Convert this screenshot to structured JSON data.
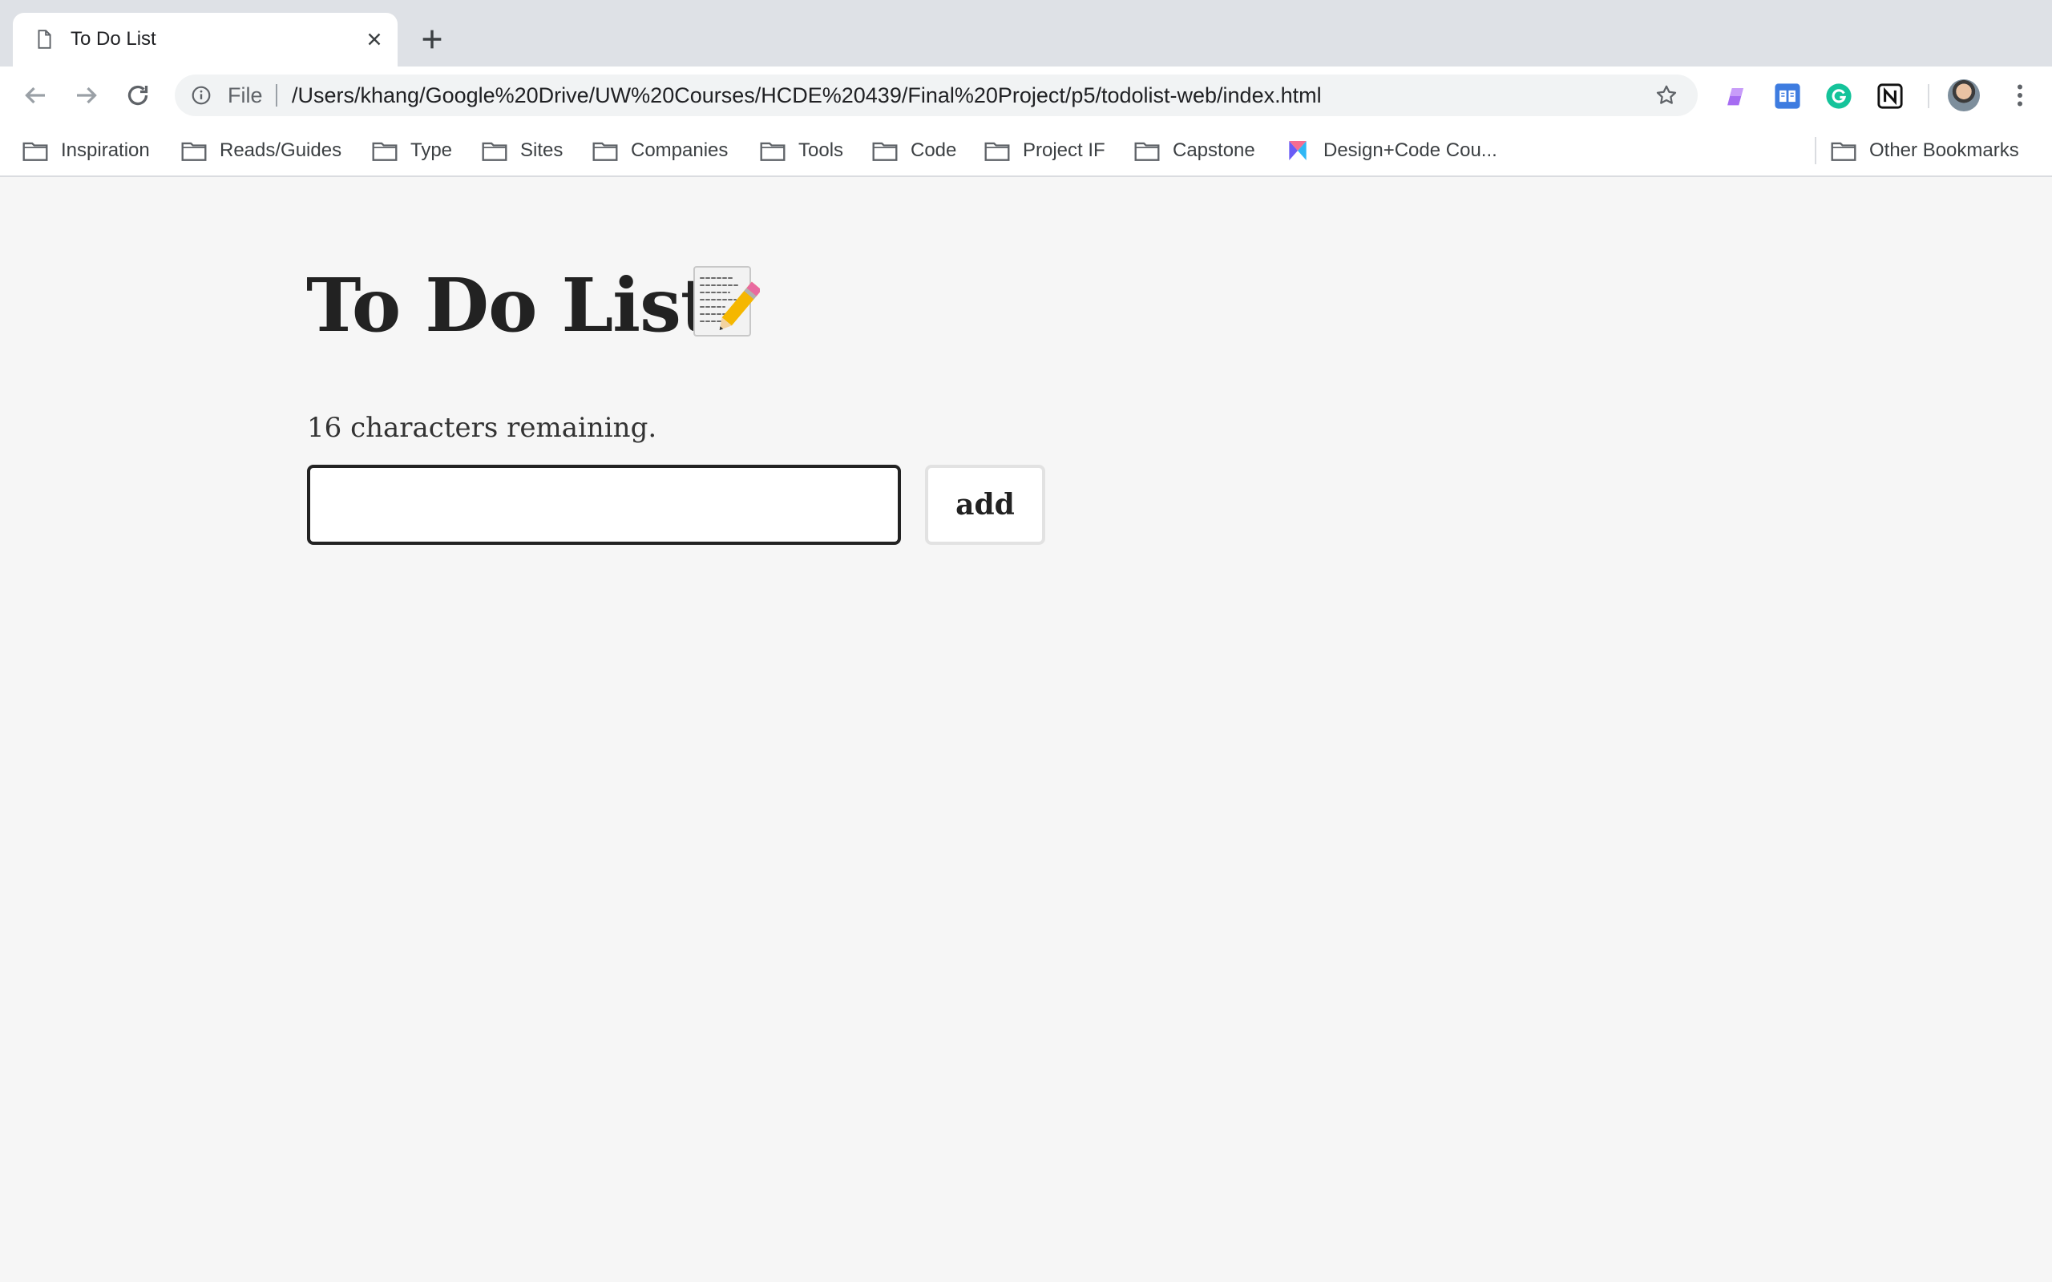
{
  "browser": {
    "tab": {
      "title": "To Do List"
    },
    "omnibox": {
      "scheme": "File",
      "url": "/Users/khang/Google%20Drive/UW%20Courses/HCDE%20439/Final%20Project/p5/todolist-web/index.html"
    },
    "bookmarks": [
      {
        "label": "Inspiration",
        "icon": "folder-icon"
      },
      {
        "label": "Reads/Guides",
        "icon": "folder-icon"
      },
      {
        "label": "Type",
        "icon": "folder-icon"
      },
      {
        "label": "Sites",
        "icon": "folder-icon"
      },
      {
        "label": "Companies",
        "icon": "folder-icon"
      },
      {
        "label": "Tools",
        "icon": "folder-icon"
      },
      {
        "label": "Code",
        "icon": "folder-icon"
      },
      {
        "label": "Project IF",
        "icon": "folder-icon"
      },
      {
        "label": "Capstone",
        "icon": "folder-icon"
      },
      {
        "label": "Design+Code Cou...",
        "icon": "design-code-logo-icon"
      }
    ],
    "other_bookmarks": "Other Bookmarks",
    "extensions": [
      "color-picker-extension-icon",
      "reader-extension-icon",
      "grammarly-extension-icon",
      "notion-extension-icon"
    ],
    "colors": {
      "tabstrip": "#dee1e6",
      "toolbar": "#ffffff",
      "omnibox": "#f1f3f4"
    }
  },
  "page": {
    "title": "To Do List",
    "title_icon": "memo-icon",
    "remaining_text": "16 characters remaining.",
    "input": {
      "value": "",
      "placeholder": ""
    },
    "add_button_label": "add",
    "colors": {
      "background": "#f6f6f6",
      "text": "#222222",
      "input_border": "#222222",
      "button_border": "#e2e2e2"
    }
  }
}
